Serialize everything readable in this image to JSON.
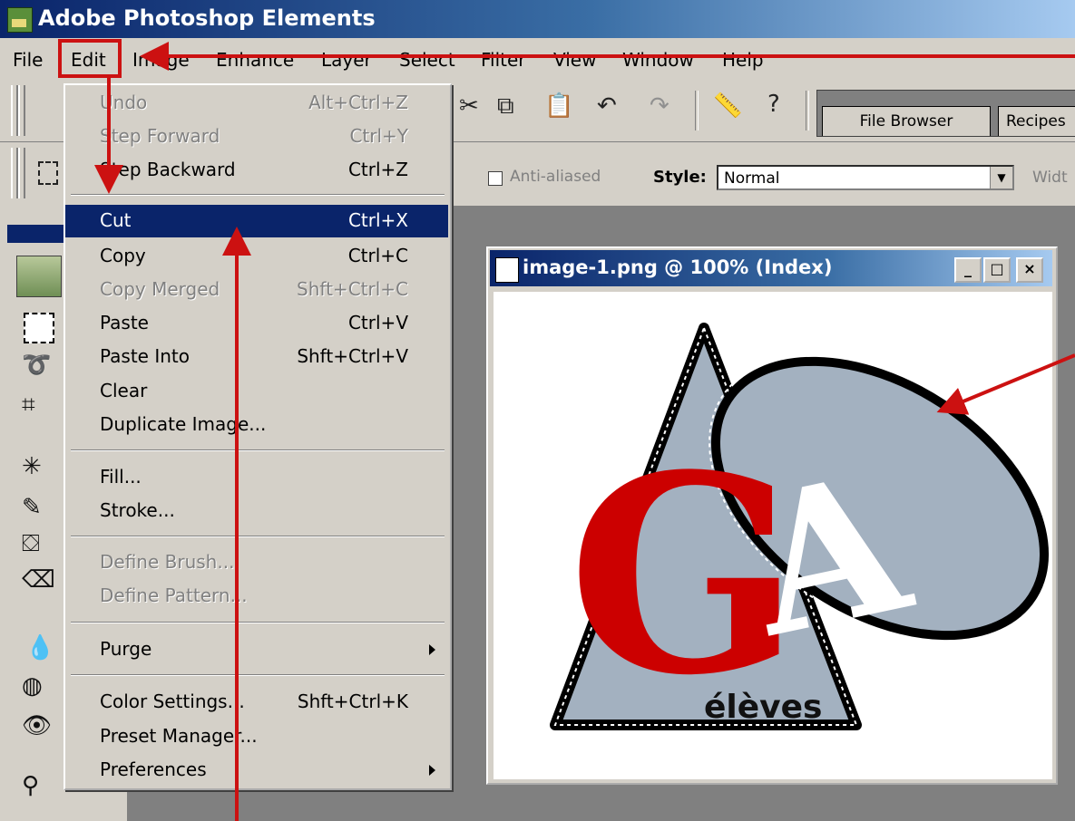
{
  "window": {
    "title": "Adobe Photoshop Elements"
  },
  "menubar": [
    "File",
    "Edit",
    "Image",
    "Enhance",
    "Layer",
    "Select",
    "Filter",
    "View",
    "Window",
    "Help"
  ],
  "toolbar": {
    "tabs": [
      "File Browser",
      "Recipes"
    ]
  },
  "options_bar": {
    "anti_aliased_label": "Anti-aliased",
    "style_label": "Style:",
    "style_value": "Normal",
    "width_label": "Widt"
  },
  "document": {
    "title": "image-1.png @ 100% (Index)",
    "window_buttons": [
      "_",
      "□",
      "×"
    ],
    "logo": {
      "letter_g": "G",
      "letter_a": "A",
      "caption": "élèves"
    }
  },
  "edit_menu": [
    {
      "label": "Undo",
      "shortcut": "Alt+Ctrl+Z",
      "disabled": true
    },
    {
      "label": "Step Forward",
      "shortcut": "Ctrl+Y",
      "disabled": true
    },
    {
      "label": "Step Backward",
      "shortcut": "Ctrl+Z"
    },
    {
      "separator": true
    },
    {
      "label": "Cut",
      "shortcut": "Ctrl+X",
      "selected": true
    },
    {
      "label": "Copy",
      "shortcut": "Ctrl+C"
    },
    {
      "label": "Copy Merged",
      "shortcut": "Shft+Ctrl+C",
      "disabled": true
    },
    {
      "label": "Paste",
      "shortcut": "Ctrl+V"
    },
    {
      "label": "Paste Into",
      "shortcut": "Shft+Ctrl+V"
    },
    {
      "label": "Clear",
      "shortcut": ""
    },
    {
      "label": "Duplicate Image...",
      "shortcut": ""
    },
    {
      "separator": true
    },
    {
      "label": "Fill...",
      "shortcut": ""
    },
    {
      "label": "Stroke...",
      "shortcut": ""
    },
    {
      "separator": true
    },
    {
      "label": "Define Brush...",
      "shortcut": "",
      "disabled": true
    },
    {
      "label": "Define Pattern...",
      "shortcut": "",
      "disabled": true
    },
    {
      "separator": true
    },
    {
      "label": "Purge",
      "shortcut": "",
      "submenu": true
    },
    {
      "separator": true
    },
    {
      "label": "Color Settings...",
      "shortcut": "Shft+Ctrl+K"
    },
    {
      "label": "Preset Manager...",
      "shortcut": ""
    },
    {
      "label": "Preferences",
      "shortcut": "",
      "submenu": true
    }
  ],
  "colors": {
    "selection": "#0a246a",
    "annotation": "#cc1111",
    "logo_red": "#cc0000",
    "logo_gray": "#a3b1c0"
  }
}
